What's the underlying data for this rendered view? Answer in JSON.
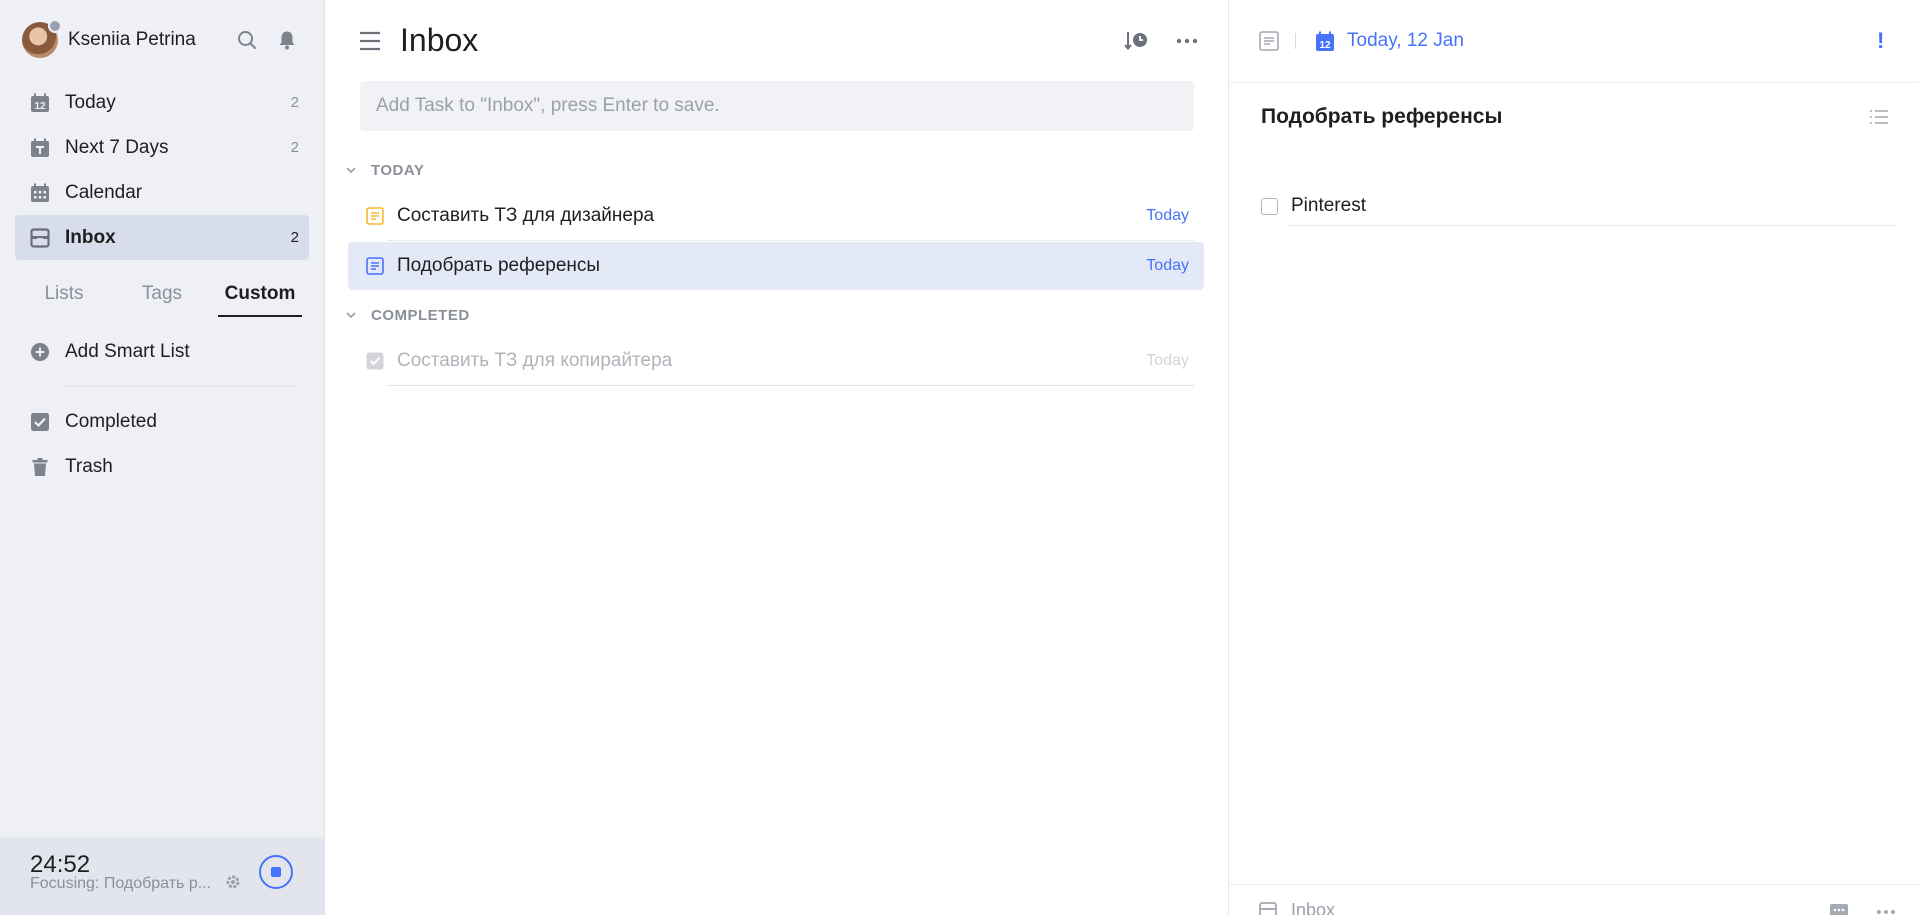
{
  "user": {
    "name": "Kseniia Petrina"
  },
  "sidebar": {
    "nav": [
      {
        "label": "Today",
        "count": "2",
        "icon": "today-icon"
      },
      {
        "label": "Next 7 Days",
        "count": "2",
        "icon": "next-7-days-icon"
      },
      {
        "label": "Calendar",
        "count": "",
        "icon": "calendar-icon"
      },
      {
        "label": "Inbox",
        "count": "2",
        "icon": "inbox-icon"
      }
    ],
    "tabs": [
      "Lists",
      "Tags",
      "Custom"
    ],
    "active_tab": "Custom",
    "add_smart_list": "Add Smart List",
    "bottom_nav": [
      {
        "label": "Completed",
        "icon": "completed-icon"
      },
      {
        "label": "Trash",
        "icon": "trash-icon"
      }
    ]
  },
  "focus": {
    "time": "24:52",
    "subtitle": "Focusing: Подобрать р..."
  },
  "main": {
    "title": "Inbox",
    "add_task_placeholder": "Add Task to \"Inbox\", press Enter to save.",
    "sections": [
      {
        "title": "TODAY",
        "tasks": [
          {
            "title": "Составить ТЗ для дизайнера",
            "date": "Today",
            "icon": "note-icon-yellow"
          },
          {
            "title": "Подобрать референсы",
            "date": "Today",
            "icon": "note-icon-blue",
            "selected": true
          }
        ]
      },
      {
        "title": "COMPLETED",
        "tasks": [
          {
            "title": "Составить ТЗ для копирайтера",
            "date": "Today",
            "icon": "checked-checkbox-icon",
            "done": true
          }
        ]
      }
    ]
  },
  "detail": {
    "date": "Today, 12 Jan",
    "calendar_day": "12",
    "priority": "!",
    "title": "Подобрать референсы",
    "subtasks": [
      {
        "label": "Pinterest",
        "checked": false
      }
    ],
    "footer_list": "Inbox"
  },
  "colors": {
    "accent": "#4772fa",
    "sidebar_bg": "#eef0f6",
    "selected_row": "#e4e9f8",
    "note_yellow": "#f5b82e"
  }
}
